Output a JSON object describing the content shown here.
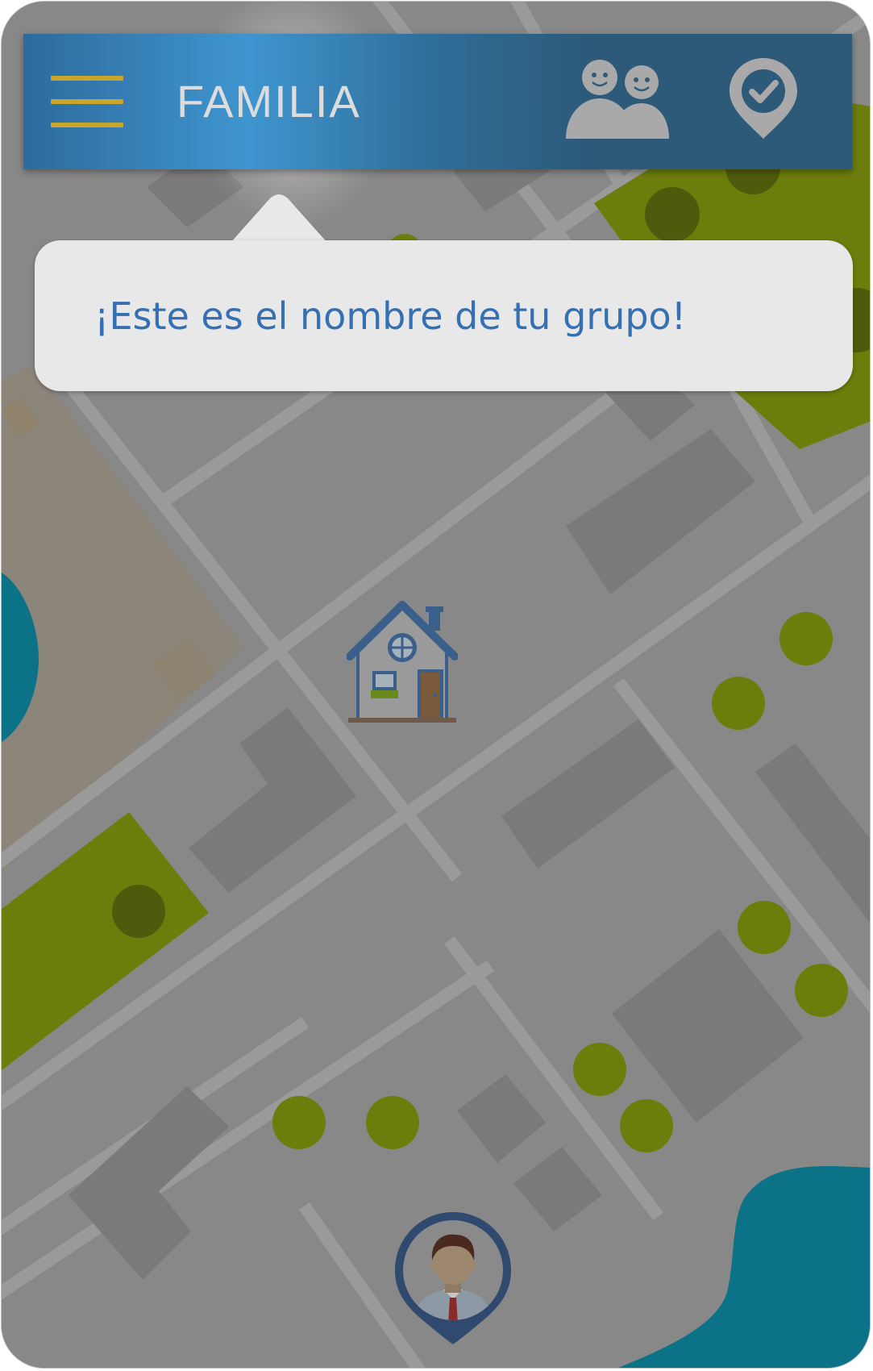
{
  "header": {
    "group_name": "FAMILIA",
    "menu_icon": "hamburger-menu-icon",
    "members_icon": "group-members-icon",
    "checkin_icon": "location-check-icon"
  },
  "tooltip": {
    "message": "¡Este es el nombre de tu grupo!"
  },
  "map": {
    "house_icon": "house-icon",
    "user_icon": "user-avatar-pin-icon"
  },
  "colors": {
    "topbar": "#2d5a79",
    "menu_lines": "#c8a52b",
    "tooltip_text": "#3570b3",
    "park": "#6c7d0c",
    "water": "#0b7287",
    "map_bg": "#888888"
  }
}
